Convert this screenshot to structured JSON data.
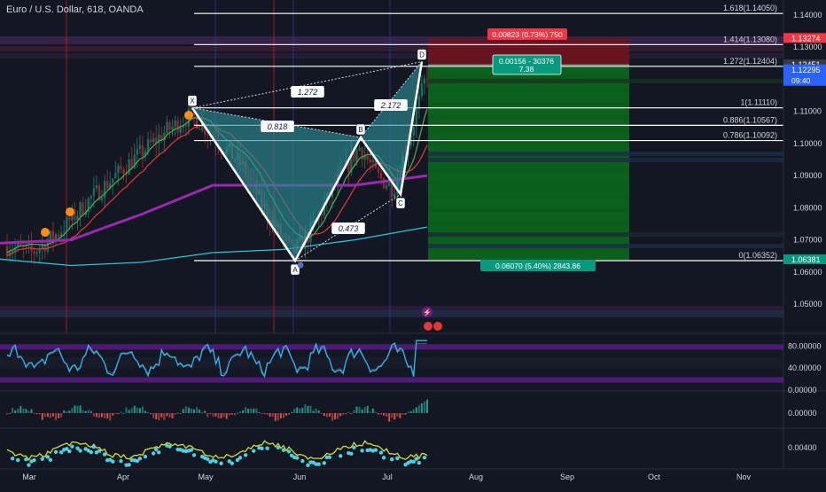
{
  "header": {
    "symbol": "Euro / U.S. Dollar, 618, OANDA"
  },
  "colors": {
    "background": "#131722",
    "axis_text": "#d1d4dc",
    "pattern_fill": "#2b8a94",
    "pattern_line": "#ffffff",
    "stop_zone": "#6b1320",
    "target_zone": "#0c6d1c",
    "candle_up": "#1d6b5c",
    "candle_down": "#8b2a2a",
    "ma_green": "#4caf50",
    "ma_red": "#e53935",
    "ma_purple": "#9c27b0",
    "ma_cyan": "#26c6da",
    "dots": "#ff8c1a",
    "price_tag_red": "#f23645",
    "price_tag_blue": "#2962ff",
    "price_tag_green": "#089981"
  },
  "chart_data": {
    "type": "candlestick",
    "title": "Euro / U.S. Dollar, 618, OANDA",
    "x_tick_labels": [
      "Mar",
      "Apr",
      "May",
      "Jun",
      "Jul",
      "Aug",
      "Sep",
      "Oct",
      "Nov"
    ],
    "y_ticks": [
      "1.14000",
      "1.13000",
      "1.12000",
      "1.11000",
      "1.10000",
      "1.09000",
      "1.08000",
      "1.07000",
      "1.06000",
      "1.05000"
    ],
    "y_ticks_values": [
      1.14,
      1.13,
      1.12,
      1.11,
      1.1,
      1.09,
      1.08,
      1.07,
      1.06,
      1.05
    ],
    "ylim": [
      1.0427,
      1.1468
    ],
    "price_tags": [
      {
        "label": "1.13274",
        "value": 1.13274,
        "kind": "red"
      },
      {
        "label": "1.12451",
        "value": 1.12451,
        "kind": "dark"
      },
      {
        "label": "1.12295",
        "value": 1.12295,
        "kind": "blue"
      },
      {
        "label": "09:40",
        "value": 1.12295,
        "kind": "time"
      },
      {
        "label": "1.06381",
        "value": 1.06381,
        "kind": "green"
      }
    ],
    "fib_levels": [
      {
        "label": "1.618(1.14050)",
        "value": 1.1405
      },
      {
        "label": "1.414(1.13080)",
        "value": 1.1308
      },
      {
        "label": "1.272(1.12404)",
        "value": 1.12404
      },
      {
        "label": "1(1.11110)",
        "value": 1.1111
      },
      {
        "label": "0.886(1.10567)",
        "value": 1.10567
      },
      {
        "label": "0.786(1.10092)",
        "value": 1.10092
      },
      {
        "label": "0(1.06352)",
        "value": 1.06352
      }
    ],
    "harmonic_pattern": {
      "points": [
        {
          "label": "X",
          "value": 1.1111
        },
        {
          "label": "A",
          "value": 1.0635
        },
        {
          "label": "B",
          "value": 1.1019
        },
        {
          "label": "C",
          "value": 1.0842
        },
        {
          "label": "D",
          "value": 1.1255
        }
      ],
      "ratios": [
        "1.272",
        "0.818",
        "2.172",
        "0.473"
      ]
    },
    "position": {
      "entry": 1.1245,
      "stop": 1.1327,
      "target": 1.0638,
      "stop_label": "0.00823 (0.73%) 750",
      "entry_label_1": "0.00156 - 30376",
      "entry_label_2": "7.38",
      "target_label": "0.06070 (5.40%) 2843.86"
    },
    "oscillator_1": {
      "ylim": [
        0,
        100
      ],
      "ticks": [
        "80.00000",
        "40.00000",
        "0.00000"
      ],
      "ticks_values": [
        80,
        40,
        0
      ],
      "bands": [
        80,
        20
      ]
    },
    "oscillator_2": {
      "ticks": [
        "0.00000"
      ],
      "ticks_values": [
        0
      ]
    },
    "oscillator_3": {
      "ticks": [
        "0.00400"
      ],
      "ticks_values": [
        0.004
      ]
    }
  }
}
